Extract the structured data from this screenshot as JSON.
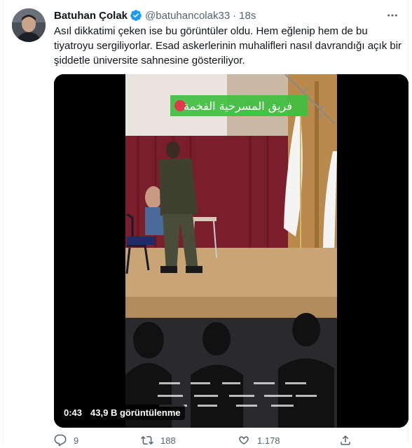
{
  "tweet": {
    "author_name": "Batuhan Çolak",
    "handle": "@batuhancolak33",
    "separator": "·",
    "time": "18s",
    "text_lines": [
      "Asıl dikkatimi çeken ise bu görüntüler oldu. Hem eğlenip hem de bu",
      "tiyatroyu sergiliyorlar. Esad askerlerinin muhalifleri nasıl davrandığı açık bir",
      "şiddetle üniversite sahnesine gösteriliyor."
    ]
  },
  "video": {
    "overlay_banner_text": "فريق المسرحية الفخمة",
    "duration": "0:43",
    "views": "43,9 B görüntülenme"
  },
  "actions": {
    "reply_count": "9",
    "retweet_count": "188",
    "like_count": "1.178",
    "share_label": ""
  },
  "colors": {
    "verified": "#1d9bf0",
    "secondary_text": "#536471",
    "curtain": "#7a1e2c",
    "banner_green": "#3fbf3f"
  },
  "icons": [
    "verified-badge-icon",
    "more-icon",
    "reply-icon",
    "retweet-icon",
    "like-icon",
    "share-icon"
  ]
}
